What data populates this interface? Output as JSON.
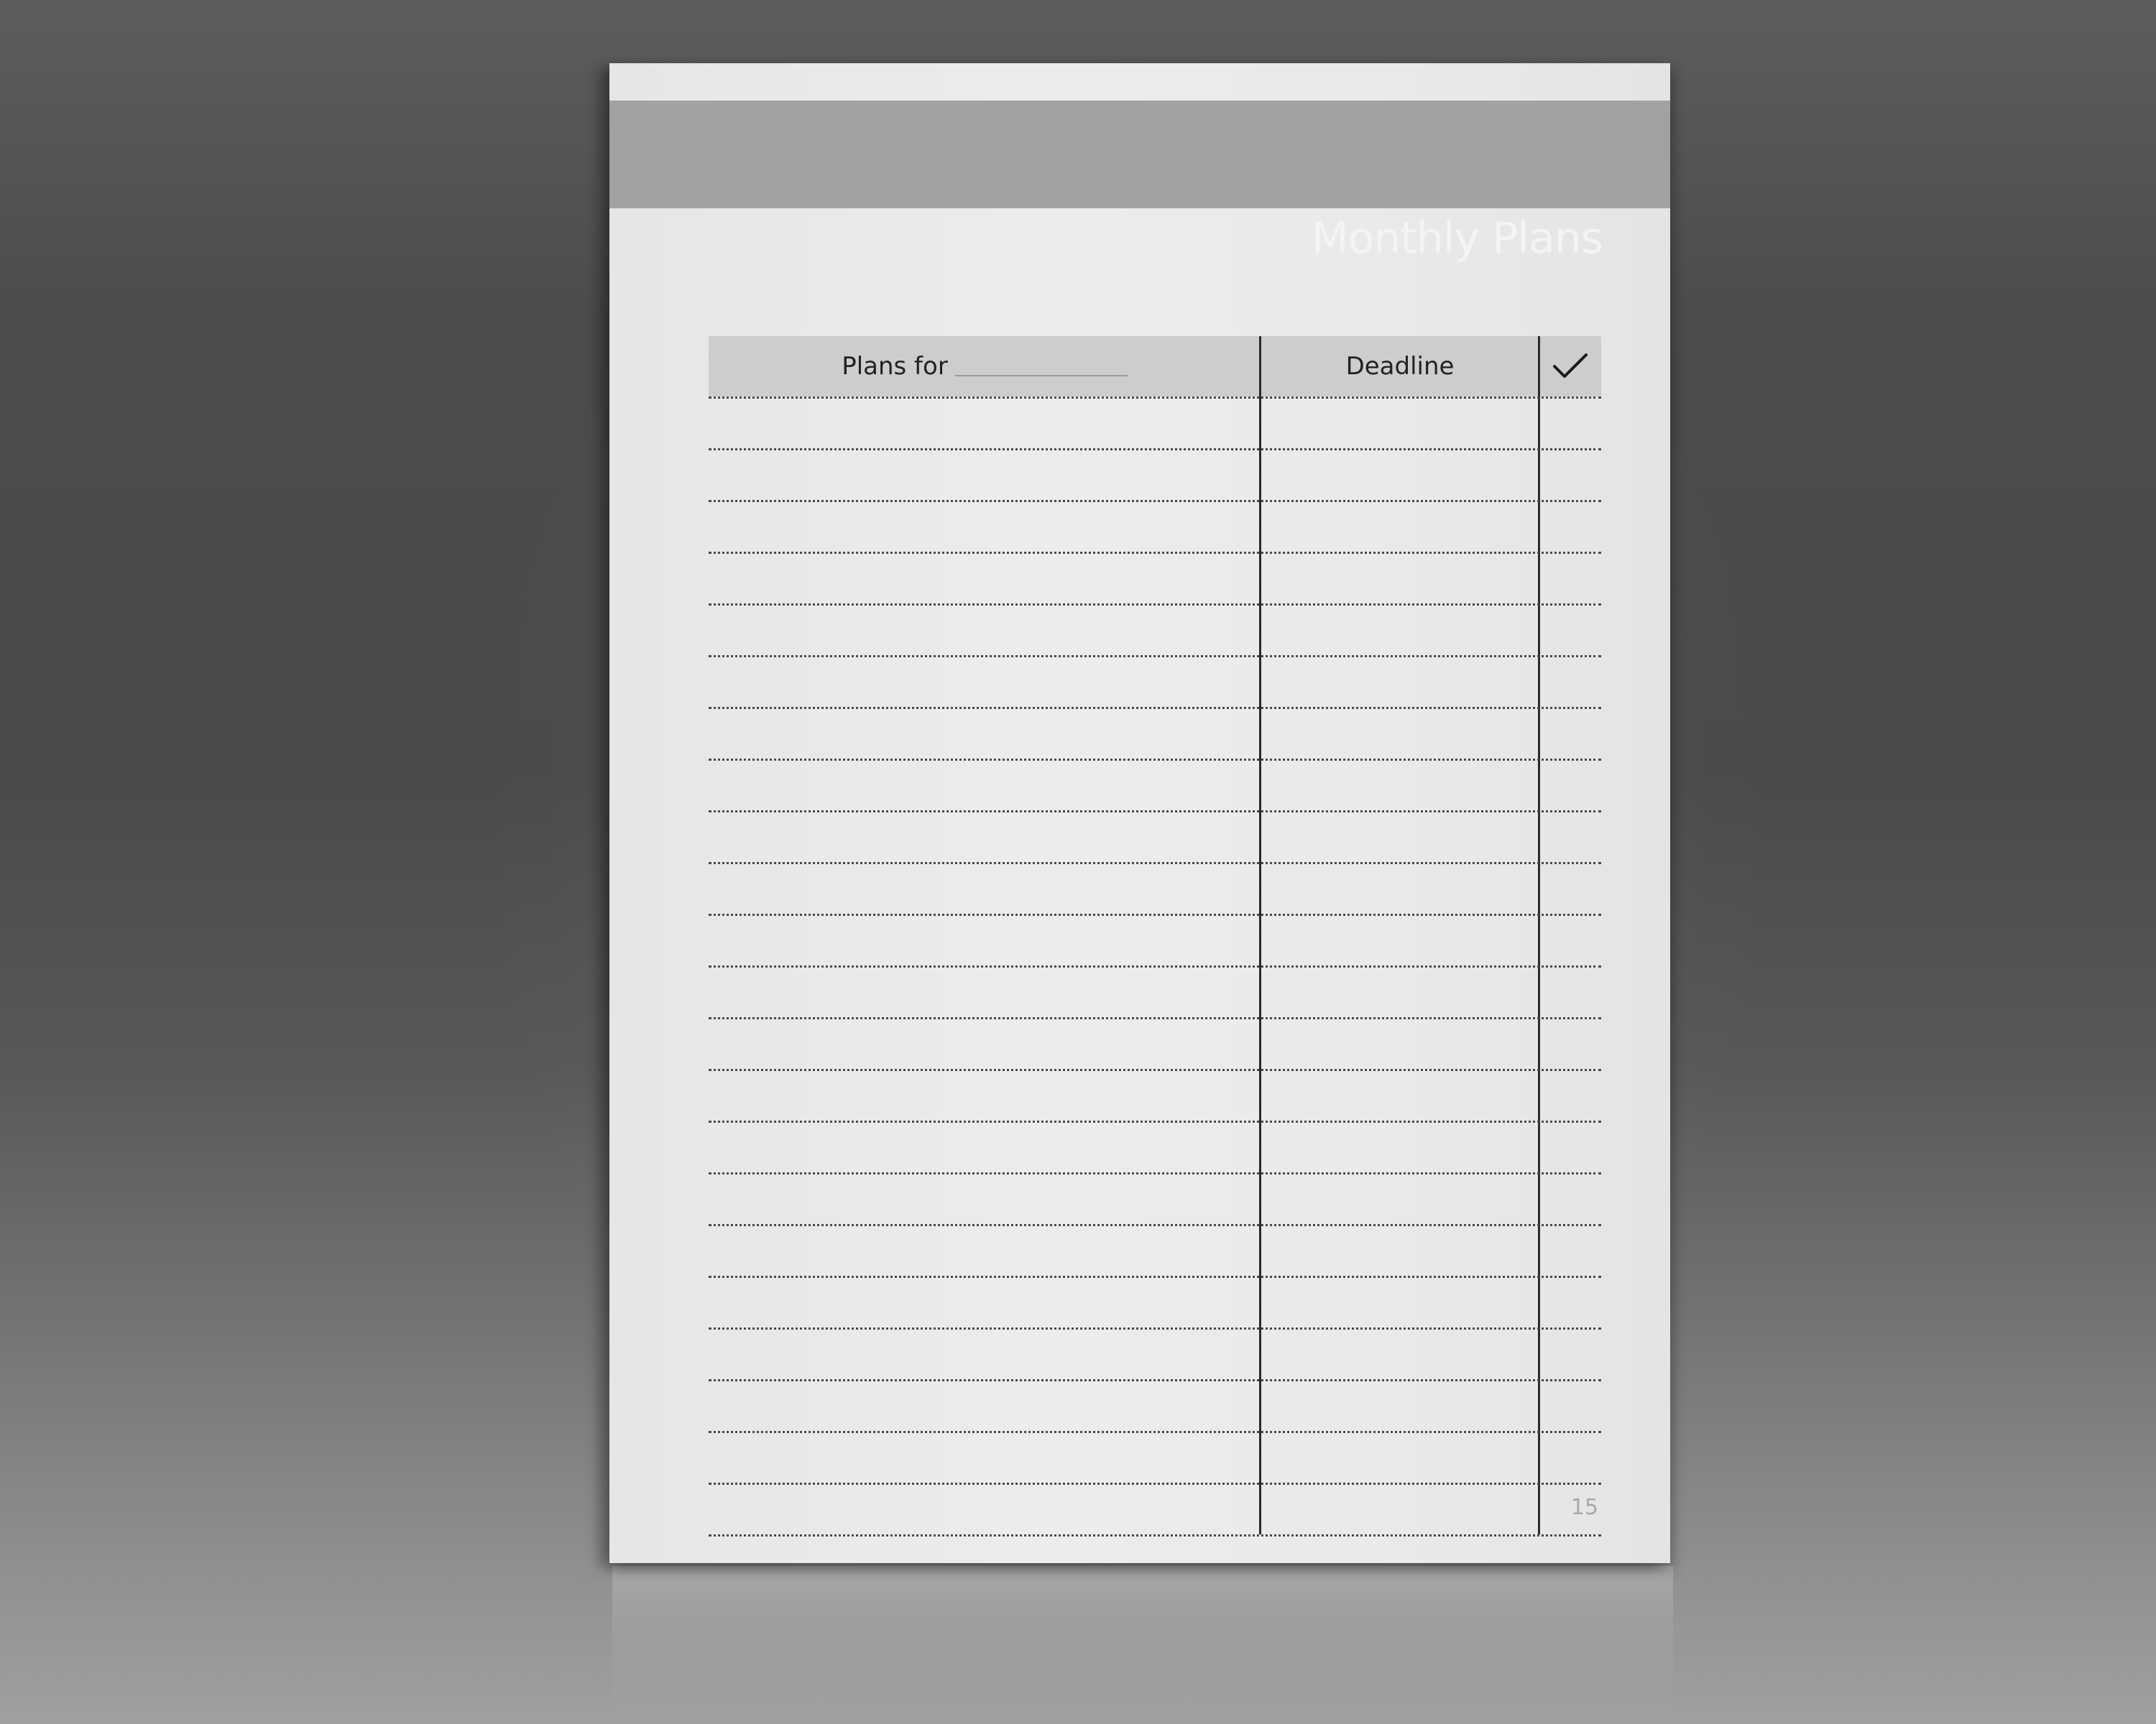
{
  "document": {
    "title": "Monthly Plans",
    "page_number": "15"
  },
  "table": {
    "headers": {
      "plans": "Plans for",
      "deadline": "Deadline",
      "done_icon": "checkmark-icon"
    },
    "row_count": 23
  }
}
